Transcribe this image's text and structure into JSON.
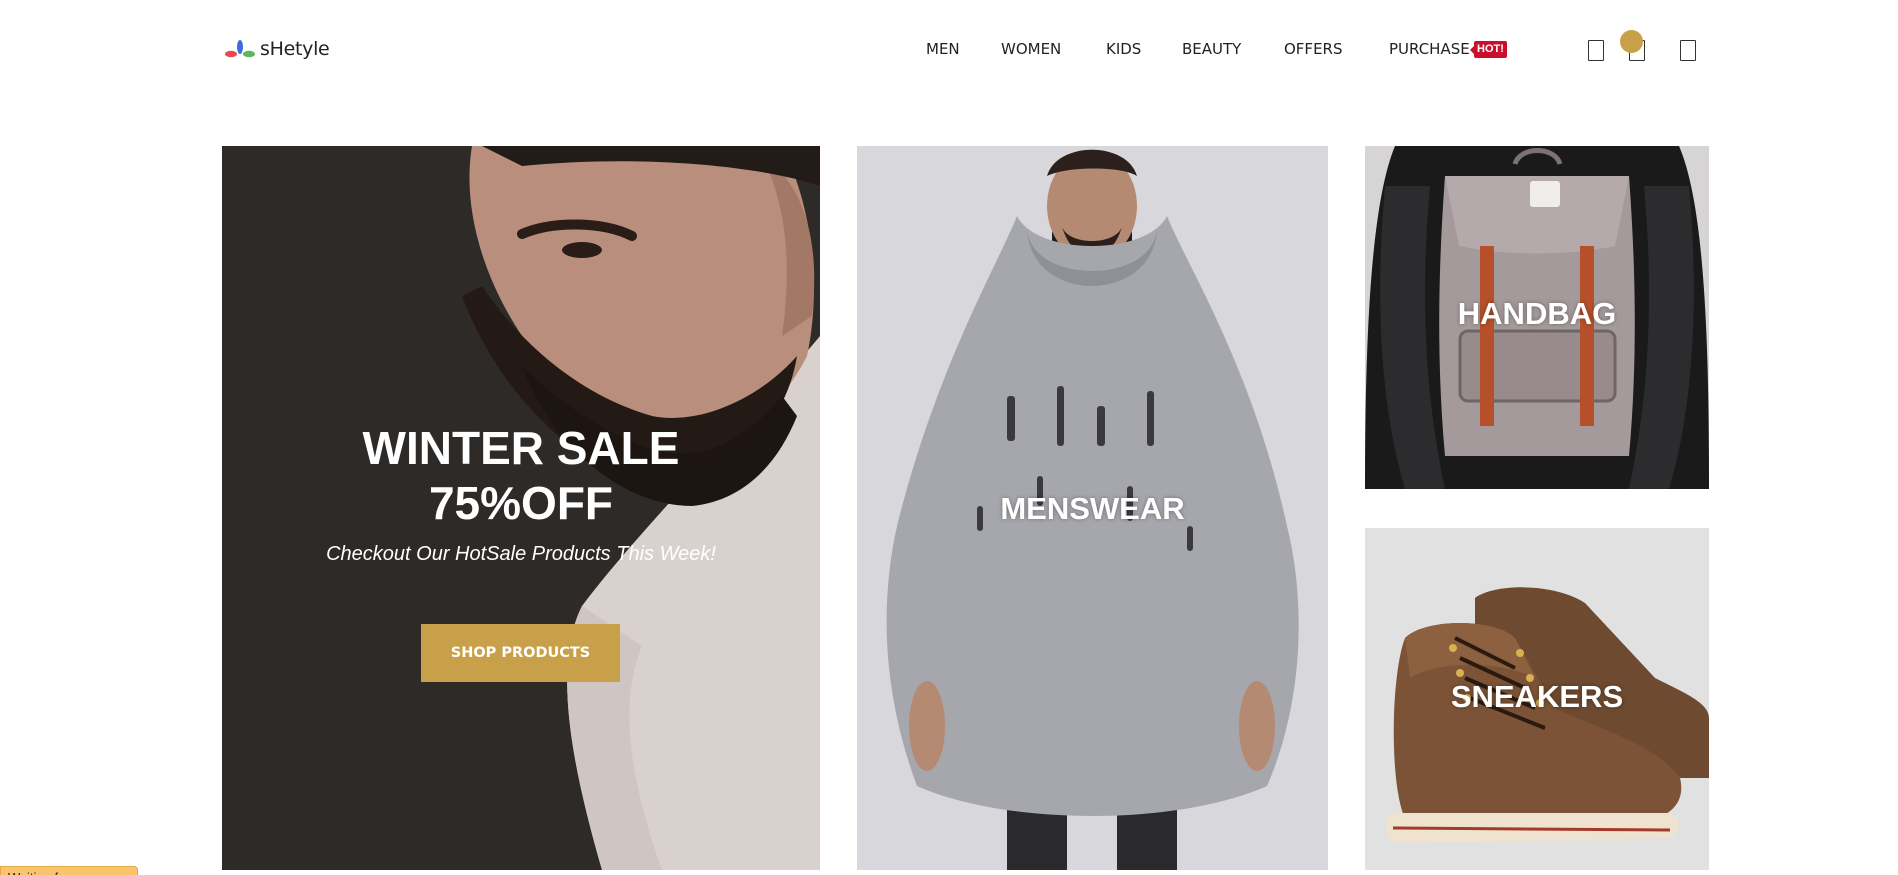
{
  "brand": {
    "name": "sHetyle",
    "logo_colors": [
      "#e94b4b",
      "#3b6fd6",
      "#5cb85c"
    ]
  },
  "nav": {
    "items": [
      "MEN",
      "WOMEN",
      "KIDS",
      "BEAUTY",
      "OFFERS",
      "PURCHASE"
    ],
    "badge": "HOT!"
  },
  "header_icons": [
    "search-icon",
    "cart-icon",
    "user-icon"
  ],
  "hero": {
    "title_line1": "WINTER SALE",
    "title_line2": "75%OFF",
    "subtitle": "Checkout Our HotSale Products This Week!",
    "button": "SHOP PRODUCTS"
  },
  "categories": {
    "menswear": "MENSWEAR",
    "handbag": "HANDBAG",
    "sneakers": "SNEAKERS"
  },
  "status_text": "Waiting for www.go...",
  "colors": {
    "accent": "#c9a04a",
    "hot": "#c8102e",
    "status": "#f9c46b"
  }
}
